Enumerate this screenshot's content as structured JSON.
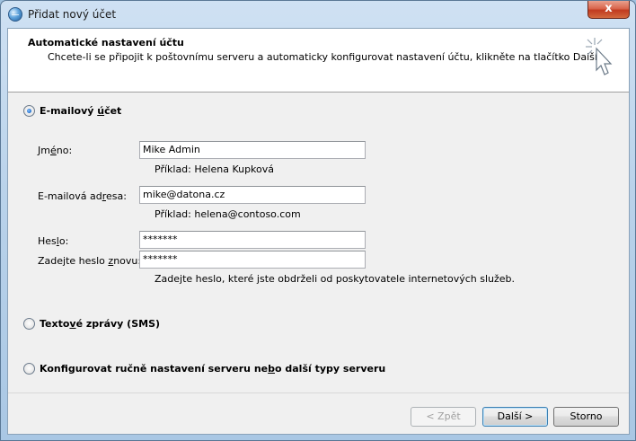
{
  "window": {
    "title": "Přidat nový účet",
    "close_label": "x",
    "app_icon": "globe-icon"
  },
  "header": {
    "title": "Automatické nastavení účtu",
    "subtitle": "Chcete-li se připojit k poštovnímu serveru a automaticky konfigurovat nastavení účtu, klikněte na tlačítko Další.",
    "art_icon": "cursor-sparkle-icon"
  },
  "options": {
    "email": {
      "label_pre": "E-mailový ",
      "label_u": "ú",
      "label_post": "čet",
      "checked": true
    },
    "sms": {
      "label_pre": "Texto",
      "label_u": "v",
      "label_post": "é zprávy (SMS)",
      "checked": false
    },
    "manual": {
      "label_pre": "Konfigurovat ručně nastavení serveru ne",
      "label_u": "b",
      "label_post": "o další typy serveru",
      "checked": false
    }
  },
  "form": {
    "name": {
      "label_pre": "Jm",
      "label_u": "é",
      "label_post": "no:",
      "value": "Mike Admin",
      "hint": "Příklad: Helena Kupková"
    },
    "email": {
      "label_pre": "E-mailová ad",
      "label_u": "r",
      "label_post": "esa:",
      "value": "mike@datona.cz",
      "hint": "Příklad: helena@contoso.com"
    },
    "password": {
      "label_pre": "Hes",
      "label_u": "l",
      "label_post": "o:",
      "value": "*******"
    },
    "password_confirm": {
      "label_pre": "Zadejte heslo ",
      "label_u": "z",
      "label_post": "novu:",
      "value": "*******",
      "hint": "Zadejte heslo, které jste obdrželi od poskytovatele internetových služeb."
    }
  },
  "buttons": {
    "back": "< Zpět",
    "next": "Další >",
    "cancel": "Storno"
  }
}
